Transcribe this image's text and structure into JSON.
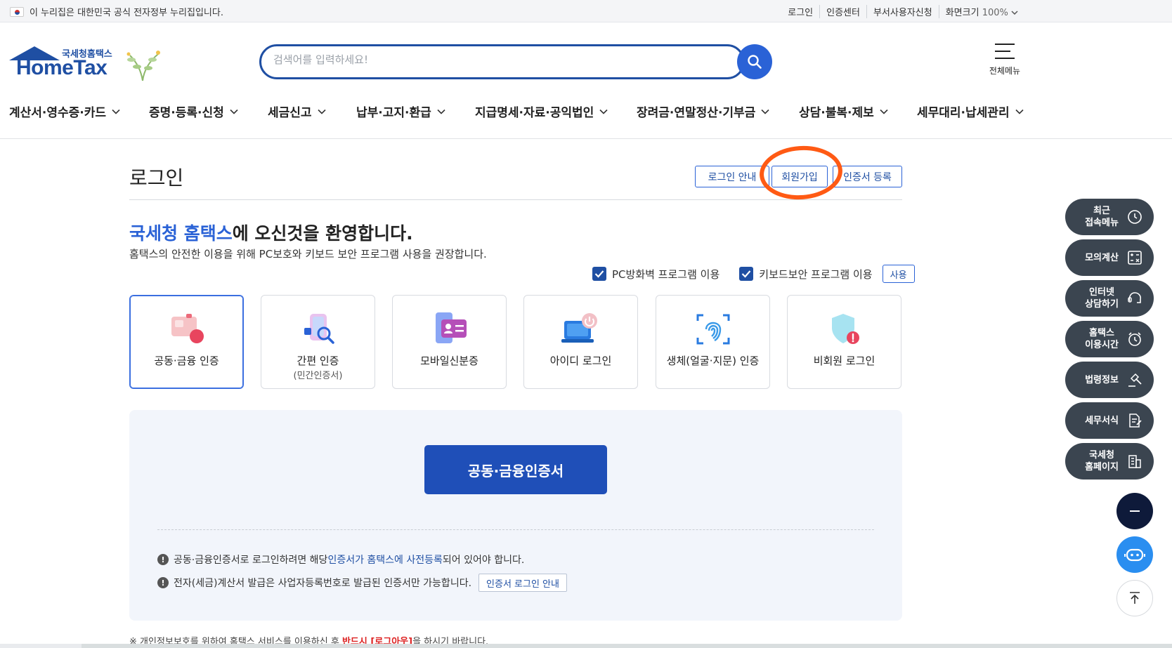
{
  "utilbar": {
    "notice": "이 누리집은 대한민국 공식 전자정부 누리집입니다.",
    "links": [
      "로그인",
      "인증센터",
      "부서사용자신청"
    ],
    "zoom_label": "화면크기",
    "zoom_value": "100%"
  },
  "header": {
    "logo_sub": "국세청홈택스",
    "logo_main": "HomeTax",
    "search_placeholder": "검색어를 입력하세요!",
    "all_menu_label": "전체메뉴"
  },
  "gnb": [
    "계산서·영수증·카드",
    "증명·등록·신청",
    "세금신고",
    "납부·고지·환급",
    "지급명세·자료·공익법인",
    "장려금·연말정산·기부금",
    "상담·불복·제보",
    "세무대리·납세관리"
  ],
  "login": {
    "title": "로그인",
    "top_buttons": [
      "로그인 안내",
      "회원가입",
      "인증서 등록"
    ],
    "welcome_em": "국세청 홈택스",
    "welcome_rest": "에 오신것을 환영합니다.",
    "description": "홈택스의 안전한 이용을 위해 PC보호와 키보드 보안 프로그램 사용을 권장합니다.",
    "checkbox_pc": "PC방화벽 프로그램 이용",
    "checkbox_keyboard": "키보드보안 프로그램 이용",
    "checkbox_pc_checked": true,
    "checkbox_keyboard_checked": true,
    "use_button": "사용",
    "methods": [
      {
        "label": "공동·금융 인증",
        "sub": "",
        "icon": "certificate-card-icon",
        "selected": true
      },
      {
        "label": "간편 인증",
        "sub": "(민간인증서)",
        "icon": "simple-auth-icon",
        "selected": false
      },
      {
        "label": "모바일신분증",
        "sub": "",
        "icon": "mobile-id-icon",
        "selected": false
      },
      {
        "label": "아이디 로그인",
        "sub": "",
        "icon": "id-login-icon",
        "selected": false
      },
      {
        "label": "생체(얼굴·지문) 인증",
        "sub": "",
        "icon": "fingerprint-icon",
        "selected": false
      },
      {
        "label": "비회원 로그인",
        "sub": "",
        "icon": "guest-shield-icon",
        "selected": false
      }
    ],
    "main_button": "공동·금융인증서",
    "note1_pre": "공동·금융인증서로 로그인하려면 해당 ",
    "note1_link": "인증서가 홈택스에 사전등록",
    "note1_post": "되어 있어야 합니다.",
    "note2": "전자(세금)계산서 발급은 사업자등록번호로 발급된 인증서만 가능합니다.",
    "note2_button": "인증서 로그인 안내",
    "footnote_pre": "※ 개인정보보호를 위하여 홈택스 서비스를 이용하신 후 ",
    "footnote_red": "반드시 [로그아웃]",
    "footnote_post": "을 하시기 바랍니다."
  },
  "quick_menu": [
    {
      "label": "최근 접속메뉴",
      "icon": "clock-icon"
    },
    {
      "label": "모의계산",
      "icon": "calculator-icon"
    },
    {
      "label": "인터넷 상담하기",
      "icon": "chat-icon"
    },
    {
      "label": "홈택스 이용시간",
      "icon": "alarm-icon"
    },
    {
      "label": "법령정보",
      "icon": "gavel-icon"
    },
    {
      "label": "세무서식",
      "icon": "document-edit-icon"
    },
    {
      "label": "국세청 홈페이지",
      "icon": "building-icon"
    }
  ],
  "colors": {
    "primary": "#1f4fa3",
    "accent": "#2a62d6",
    "quick_bg": "#3b4550",
    "annotation": "#ff5a14"
  }
}
